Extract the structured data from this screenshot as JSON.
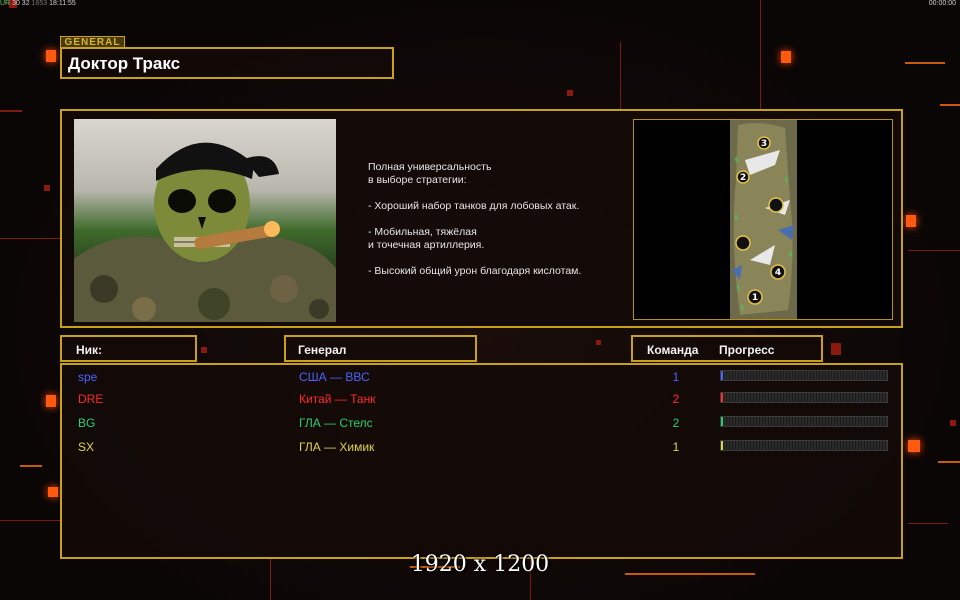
{
  "hud": {
    "left_ur": "UR",
    "left_stats": "30 32",
    "left_ping": "1653",
    "left_time": "18:11:55",
    "right_time": "00:00:00"
  },
  "general_tag": "GENERAL",
  "general_name": "Доктор Тракс",
  "description": "Полная универсальность\nв выборе стратегии:\n\n- Хороший набор танков для лобовых атак.\n\n- Мобильная, тяжёлая\nи точечная артиллерия.\n\n- Высокий общий урон благодаря кислотам.",
  "minimap": {
    "spawns": [
      "3",
      "2",
      "4",
      "1"
    ]
  },
  "headers": {
    "nick": "Ник:",
    "general": "Генерал",
    "team": "Команда",
    "progress": "Прогресс"
  },
  "players": [
    {
      "nick": "spe",
      "general": "США — ВВС",
      "team": "1",
      "color": "#4a63ff",
      "progress": 0.01
    },
    {
      "nick": "DRE",
      "general": "Китай — Танк",
      "team": "2",
      "color": "#ff2a2a",
      "progress": 0.01
    },
    {
      "nick": "BG",
      "general": "ГЛА — Стелс",
      "team": "2",
      "color": "#2ad06e",
      "progress": 0.01
    },
    {
      "nick": "SX",
      "general": "ГЛА — Химик",
      "team": "1",
      "color": "#e0d44a",
      "progress": 0.01
    }
  ],
  "resolution_label": "1920 x 1200",
  "colors": {
    "frame_gold": "#c9a019",
    "accent_orange": "#ff5a10"
  }
}
